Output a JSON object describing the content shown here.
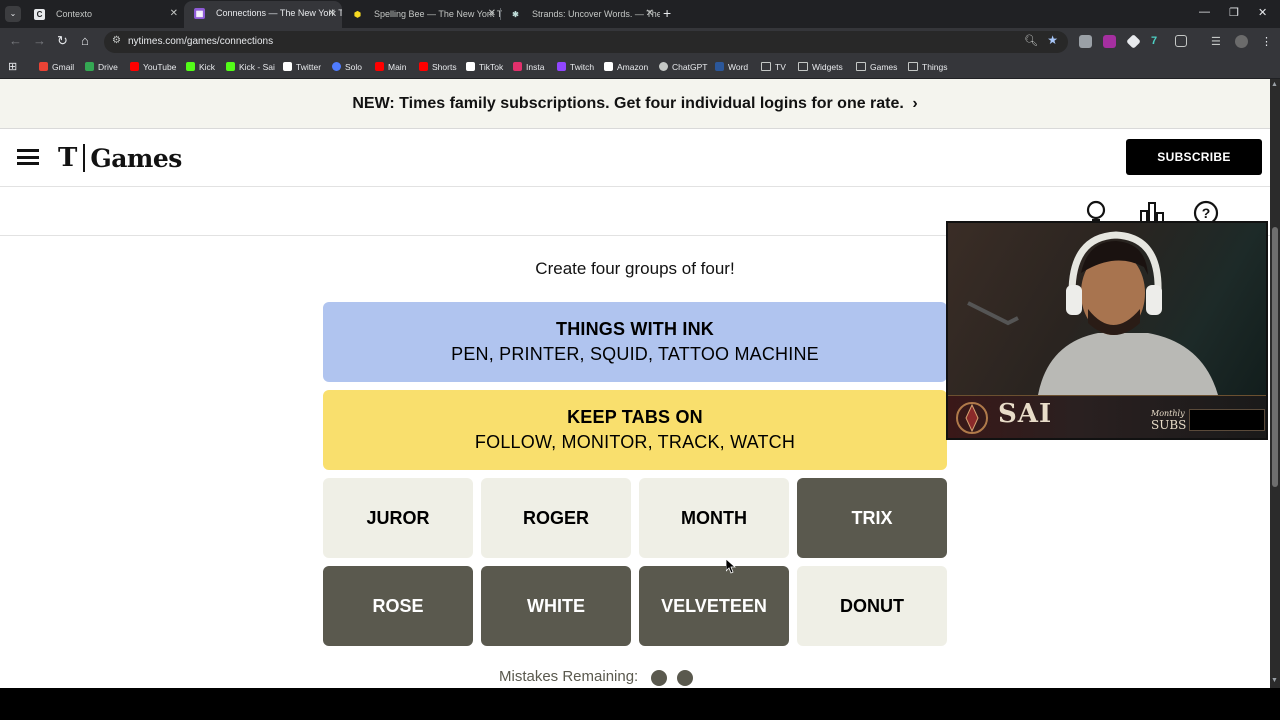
{
  "browser": {
    "tabs": [
      {
        "title": "Contexto",
        "icon": "contexto-favicon",
        "active": false
      },
      {
        "title": "Connections — The New York T",
        "icon": "nyt-connections-favicon",
        "active": true
      },
      {
        "title": "Spelling Bee — The New York T",
        "icon": "spelling-bee-favicon",
        "active": false
      },
      {
        "title": "Strands: Uncover Words. — The",
        "icon": "strands-favicon",
        "active": false
      }
    ],
    "url": "nytimes.com/games/connections",
    "bookmarks": [
      {
        "label": "Gmail",
        "color": "#ea4335"
      },
      {
        "label": "Drive",
        "color": "#34a853"
      },
      {
        "label": "YouTube",
        "color": "#ff0000"
      },
      {
        "label": "Kick",
        "color": "#53fc18"
      },
      {
        "label": "Kick - Sai",
        "color": "#53fc18"
      },
      {
        "label": "Twitter",
        "color": "#ffffff"
      },
      {
        "label": "Solo",
        "color": "#4f7cff"
      },
      {
        "label": "Main",
        "color": "#ff0000"
      },
      {
        "label": "Shorts",
        "color": "#ff0000"
      },
      {
        "label": "TikTok",
        "color": "#ffffff"
      },
      {
        "label": "Insta",
        "color": "#e1306c"
      },
      {
        "label": "Twitch",
        "color": "#9146ff"
      },
      {
        "label": "Amazon",
        "color": "#ffffff"
      },
      {
        "label": "ChatGPT",
        "color": "#c4c7c5"
      },
      {
        "label": "Word",
        "color": "#2b579a"
      },
      {
        "label": "TV",
        "color": "folder"
      },
      {
        "label": "Widgets",
        "color": "folder"
      },
      {
        "label": "Games",
        "color": "folder"
      },
      {
        "label": "Things",
        "color": "folder"
      }
    ]
  },
  "promo": {
    "text": "NEW: Times family subscriptions. Get four individual logins for one rate.",
    "chevron": "›"
  },
  "header": {
    "logo_t": "T",
    "logo_text": "Games",
    "subscribe_label": "SUBSCRIBE"
  },
  "game": {
    "instructions": "Create four groups of four!",
    "solved": [
      {
        "category": "THINGS WITH INK",
        "words": "PEN, PRINTER, SQUID, TATTOO MACHINE",
        "color": "#b0c4ef"
      },
      {
        "category": "KEEP TABS ON",
        "words": "FOLLOW, MONITOR, TRACK, WATCH",
        "color": "#f9df6d"
      }
    ],
    "cards": [
      {
        "word": "JUROR",
        "selected": false
      },
      {
        "word": "ROGER",
        "selected": false
      },
      {
        "word": "MONTH",
        "selected": false
      },
      {
        "word": "TRIX",
        "selected": true
      },
      {
        "word": "ROSE",
        "selected": true
      },
      {
        "word": "WHITE",
        "selected": true
      },
      {
        "word": "VELVETEEN",
        "selected": true
      },
      {
        "word": "DONUT",
        "selected": false
      }
    ],
    "mistakes_label": "Mistakes Remaining:",
    "mistakes_remaining": 2
  },
  "webcam": {
    "name": "SAI",
    "sub_label_top": "Monthly",
    "sub_label_bottom": "SUBS"
  },
  "colors": {
    "selected_card": "#5a594e",
    "unselected_card": "#efefe6",
    "promo_bg": "#f4f4ee"
  }
}
